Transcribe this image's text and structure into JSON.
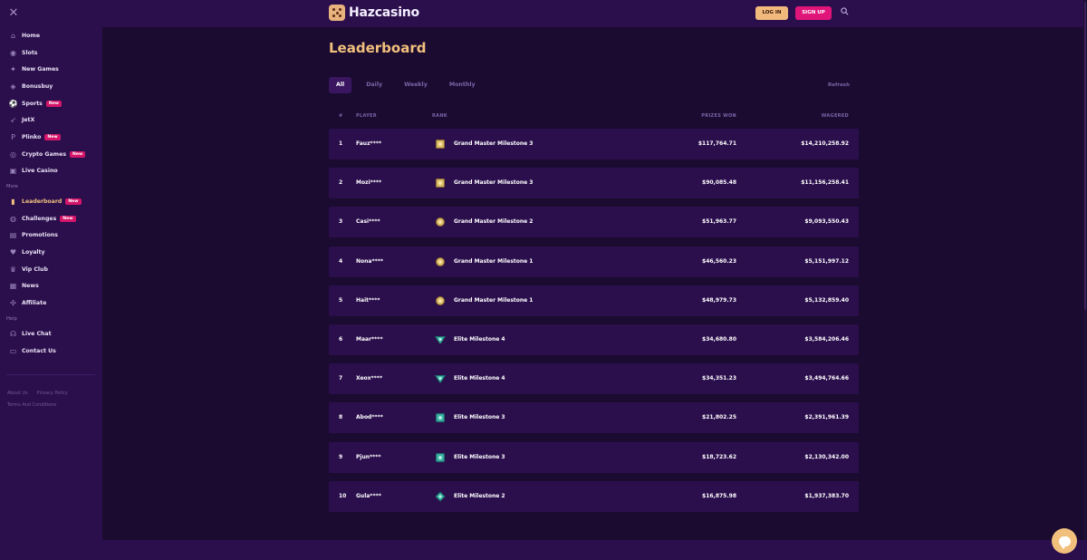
{
  "app": {
    "brand": "Hazcasino"
  },
  "header": {
    "login_label": "LOG IN",
    "signup_label": "SIGN UP"
  },
  "sidebar": {
    "main_items": [
      {
        "label": "Home",
        "icon": "home-icon",
        "badge": ""
      },
      {
        "label": "Slots",
        "icon": "slots-icon",
        "badge": ""
      },
      {
        "label": "New Games",
        "icon": "new-games-icon",
        "badge": ""
      },
      {
        "label": "Bonusbuy",
        "icon": "bonusbuy-icon",
        "badge": ""
      },
      {
        "label": "Sports",
        "icon": "sports-icon",
        "badge": "New"
      },
      {
        "label": "JetX",
        "icon": "rocket-icon",
        "badge": ""
      },
      {
        "label": "Plinko",
        "icon": "plinko-icon",
        "badge": "New"
      },
      {
        "label": "Crypto Games",
        "icon": "crypto-icon",
        "badge": "New"
      },
      {
        "label": "Live Casino",
        "icon": "live-casino-icon",
        "badge": ""
      }
    ],
    "more_label": "More",
    "more_items": [
      {
        "label": "Leaderboard",
        "icon": "leaderboard-icon",
        "badge": "New"
      },
      {
        "label": "Challenges",
        "icon": "challenges-icon",
        "badge": "New"
      },
      {
        "label": "Promotions",
        "icon": "gift-icon",
        "badge": ""
      },
      {
        "label": "Loyalty",
        "icon": "heart-icon",
        "badge": ""
      },
      {
        "label": "Vip Club",
        "icon": "crown-icon",
        "badge": ""
      },
      {
        "label": "News",
        "icon": "news-icon",
        "badge": ""
      },
      {
        "label": "Affiliate",
        "icon": "affiliate-icon",
        "badge": ""
      }
    ],
    "help_label": "Help",
    "help_items": [
      {
        "label": "Live Chat",
        "icon": "headset-icon",
        "badge": ""
      },
      {
        "label": "Contact Us",
        "icon": "chat-icon",
        "badge": ""
      }
    ],
    "footer_links": [
      "About Us",
      "Privacy Policy",
      "Terms And Conditions"
    ]
  },
  "main": {
    "title": "Leaderboard",
    "tabs": [
      {
        "label": "All",
        "active": true
      },
      {
        "label": "Daily",
        "active": false
      },
      {
        "label": "Weekly",
        "active": false
      },
      {
        "label": "Monthly",
        "active": false
      }
    ],
    "refresh_label": "Refresh",
    "columns": {
      "num": "#",
      "player": "PLAYER",
      "rank": "RANK",
      "prizes": "PRIZES WON",
      "wagered": "WAGERED"
    },
    "rows": [
      {
        "num": "1",
        "player": "Fauz****",
        "rank": "Grand Master Milestone 3",
        "medal": "grand-master-3-icon",
        "prizes": "$117,764.71",
        "wagered": "$14,210,258.92"
      },
      {
        "num": "2",
        "player": "Mozi****",
        "rank": "Grand Master Milestone 3",
        "medal": "grand-master-3-icon",
        "prizes": "$90,085.48",
        "wagered": "$11,156,258.41"
      },
      {
        "num": "3",
        "player": "Casi****",
        "rank": "Grand Master Milestone 2",
        "medal": "grand-master-2-icon",
        "prizes": "$51,963.77",
        "wagered": "$9,093,550.43"
      },
      {
        "num": "4",
        "player": "Nona****",
        "rank": "Grand Master Milestone 1",
        "medal": "grand-master-1-icon",
        "prizes": "$46,560.23",
        "wagered": "$5,151,997.12"
      },
      {
        "num": "5",
        "player": "Hait****",
        "rank": "Grand Master Milestone 1",
        "medal": "grand-master-1-icon",
        "prizes": "$48,979.73",
        "wagered": "$5,132,859.40"
      },
      {
        "num": "6",
        "player": "Maar****",
        "rank": "Elite Milestone 4",
        "medal": "elite-4-icon",
        "prizes": "$34,680.80",
        "wagered": "$3,584,206.46"
      },
      {
        "num": "7",
        "player": "Xeox****",
        "rank": "Elite Milestone 4",
        "medal": "elite-4-icon",
        "prizes": "$34,351.23",
        "wagered": "$3,494,764.66"
      },
      {
        "num": "8",
        "player": "Abod****",
        "rank": "Elite Milestone 3",
        "medal": "elite-3-icon",
        "prizes": "$21,802.25",
        "wagered": "$2,391,961.39"
      },
      {
        "num": "9",
        "player": "Pjun****",
        "rank": "Elite Milestone 3",
        "medal": "elite-3-icon",
        "prizes": "$18,723.62",
        "wagered": "$2,130,342.00"
      },
      {
        "num": "10",
        "player": "Gula****",
        "rank": "Elite Milestone 2",
        "medal": "elite-2-icon",
        "prizes": "$16,875.98",
        "wagered": "$1,937,383.70"
      }
    ]
  },
  "colors": {
    "accent": "#f2c07d",
    "signup": "#e0157a",
    "badge": "#d4156a",
    "sidebar": "#2b0f4d",
    "background": "#1b0b30",
    "gold_medal": "#d8b96a",
    "teal_medal": "#3fb6a8"
  }
}
